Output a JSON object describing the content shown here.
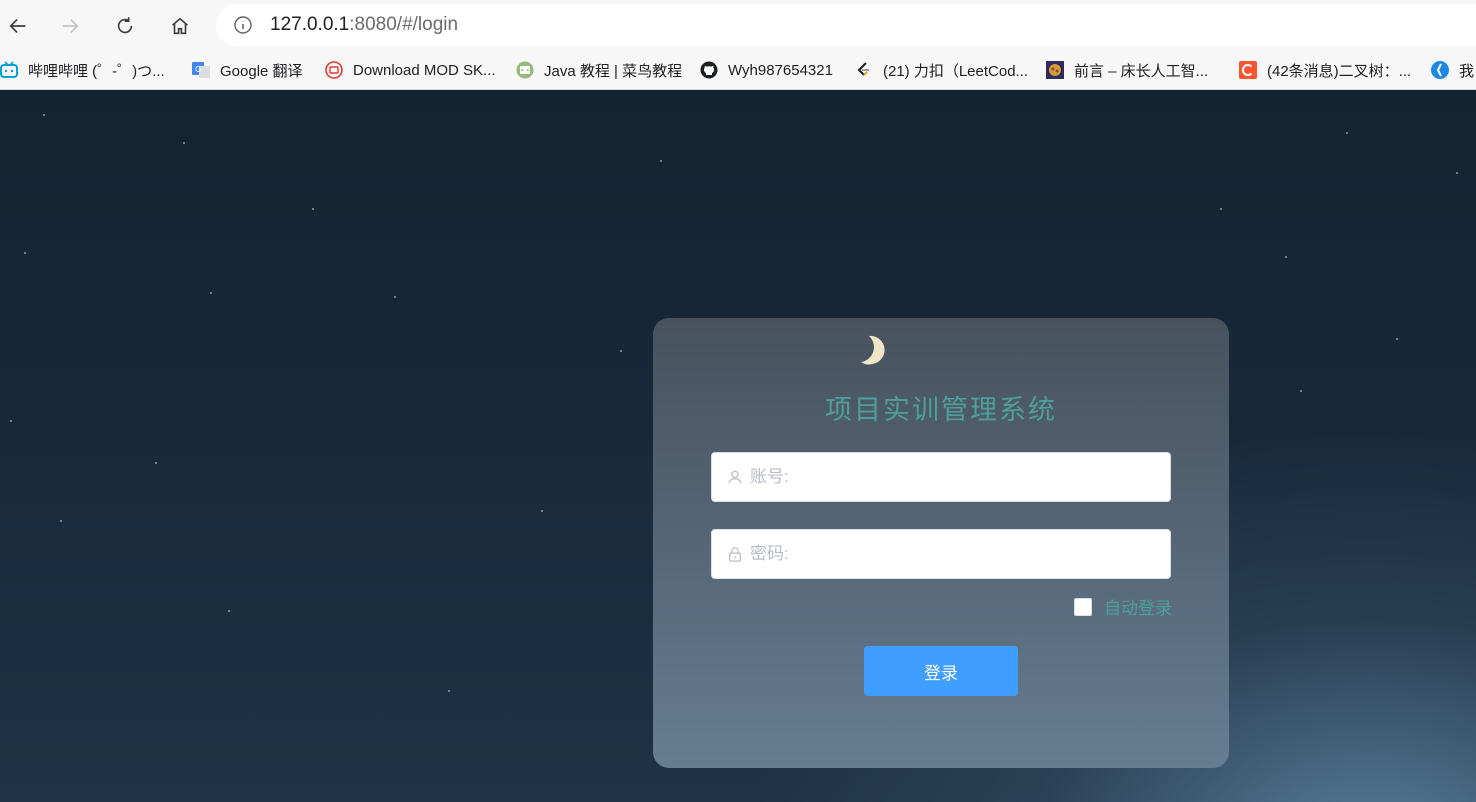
{
  "browser": {
    "url_host": "127.0.0.1",
    "url_rest": ":8080/#/login",
    "bookmarks": [
      {
        "label": "哔哩哔哩 (゜-゜)つ...",
        "icon": "bilibili-icon"
      },
      {
        "label": "Google 翻译",
        "icon": "google-translate-icon"
      },
      {
        "label": "Download MOD SK...",
        "icon": "tv-icon"
      },
      {
        "label": "Java 教程 | 菜鸟教程",
        "icon": "runoob-icon"
      },
      {
        "label": "Wyh987654321",
        "icon": "github-icon"
      },
      {
        "label": "(21) 力扣（LeetCod...",
        "icon": "leetcode-icon"
      },
      {
        "label": "前言 – 床长人工智...",
        "icon": "brain-icon"
      },
      {
        "label": "(42条消息)二叉树：...",
        "icon": "csdn-icon"
      },
      {
        "label": "我",
        "icon": "blue-bookmark-icon"
      }
    ]
  },
  "login": {
    "title": "项目实训管理系统",
    "username_placeholder": "账号:",
    "password_placeholder": "密码:",
    "remember_label": "自动登录",
    "submit_label": "登录"
  },
  "colors": {
    "accent_text": "#4f9e9c",
    "button": "#409eff"
  }
}
